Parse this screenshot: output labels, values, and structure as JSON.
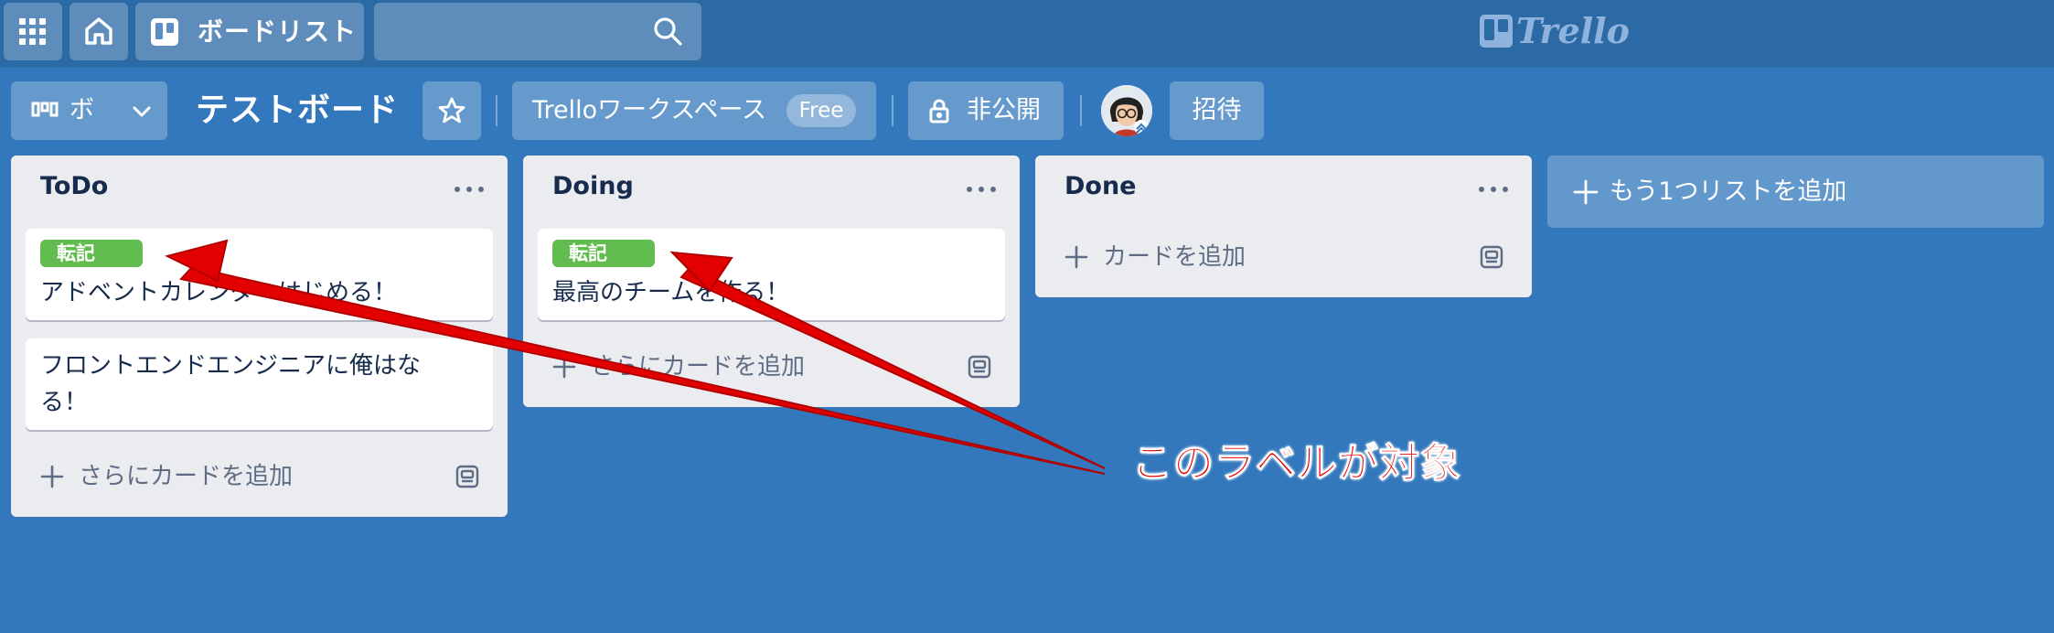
{
  "topbar": {
    "boards_label": "ボードリスト",
    "search_value": "",
    "logo_text": "Trello"
  },
  "board": {
    "view_switcher_label": "ボ",
    "title": "テストボード",
    "workspace_label": "Trelloワークスペース",
    "workspace_badge": "Free",
    "visibility_label": "非公開",
    "invite_label": "招待"
  },
  "lists": [
    {
      "title": "ToDo",
      "cards": [
        {
          "label": "転記",
          "title": "アドベントカレンダーはじめる！"
        },
        {
          "label": "",
          "title": "フロントエンドエンジニアに俺はなる！"
        }
      ],
      "add_card_label": "さらにカードを追加"
    },
    {
      "title": "Doing",
      "cards": [
        {
          "label": "転記",
          "title": "最高のチームを作る！"
        }
      ],
      "add_card_label": "さらにカードを追加"
    },
    {
      "title": "Done",
      "cards": [],
      "add_card_label": "カードを追加"
    }
  ],
  "add_list_label": "もう1つリストを追加",
  "annotation": {
    "text": "このラベルが対象",
    "color": "#e30000"
  },
  "colors": {
    "background": "#3378bc",
    "label_green": "#61bd4f",
    "list_bg": "#ebecf0"
  }
}
